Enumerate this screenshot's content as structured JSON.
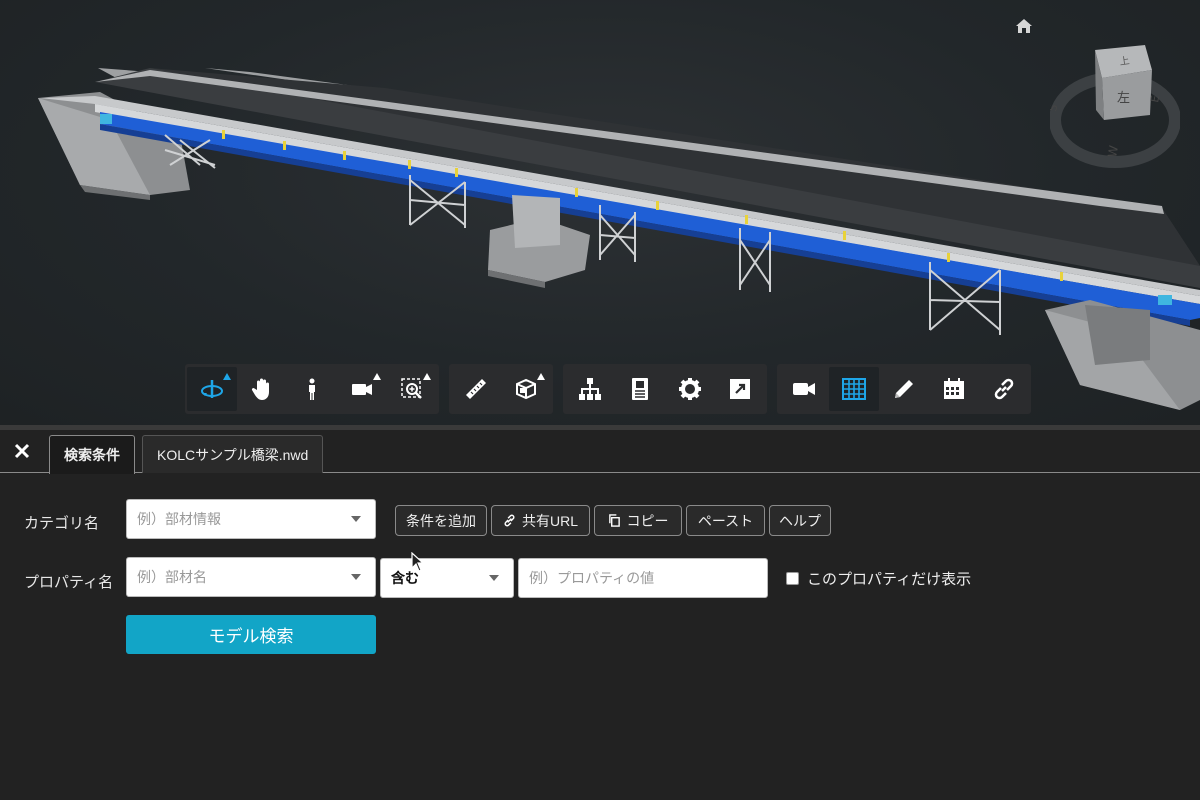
{
  "viewcube": {
    "face_top": "上",
    "face_left": "左"
  },
  "toolbar": {
    "groups": [
      [
        {
          "icon": "orbit-icon",
          "active": true,
          "has_menu": true
        },
        {
          "icon": "pan-hand-icon",
          "active": false,
          "has_menu": false
        },
        {
          "icon": "walk-person-icon",
          "active": false,
          "has_menu": false
        },
        {
          "icon": "camera-icon",
          "active": false,
          "has_menu": true
        },
        {
          "icon": "zoom-window-icon",
          "active": false,
          "has_menu": true
        }
      ],
      [
        {
          "icon": "ruler-icon",
          "active": false,
          "has_menu": false
        },
        {
          "icon": "section-box-icon",
          "active": false,
          "has_menu": true
        }
      ],
      [
        {
          "icon": "model-tree-icon",
          "active": false,
          "has_menu": false
        },
        {
          "icon": "properties-icon",
          "active": false,
          "has_menu": false
        },
        {
          "icon": "gear-icon",
          "active": false,
          "has_menu": false
        },
        {
          "icon": "fullscreen-icon",
          "active": false,
          "has_menu": false
        }
      ],
      [
        {
          "icon": "video-camera-icon",
          "active": false,
          "has_menu": false
        },
        {
          "icon": "grid-table-icon",
          "active": true,
          "has_menu": false
        },
        {
          "icon": "pencil-icon",
          "active": false,
          "has_menu": false
        },
        {
          "icon": "calendar-icon",
          "active": false,
          "has_menu": false
        },
        {
          "icon": "link-icon",
          "active": false,
          "has_menu": false
        }
      ]
    ]
  },
  "tabs": [
    {
      "label": "検索条件",
      "active": true
    },
    {
      "label": "KOLCサンプル橋梁.nwd",
      "active": false
    }
  ],
  "form": {
    "category_label": "カテゴリ名",
    "category_placeholder": "例）部材情報",
    "property_label": "プロパティ名",
    "property_placeholder": "例）部材名",
    "operator_value": "含む",
    "value_placeholder": "例）プロパティの値",
    "checkbox_label": "このプロパティだけ表示",
    "search_button": "モデル検索"
  },
  "actions": {
    "add_condition": "条件を追加",
    "share_url": "共有URL",
    "copy": "コピー",
    "paste": "ペースト",
    "help": "ヘルプ"
  },
  "colors": {
    "accent": "#12a5c7",
    "active_icon": "#1ea6e8",
    "girder_blue": "#1f5fd6"
  }
}
